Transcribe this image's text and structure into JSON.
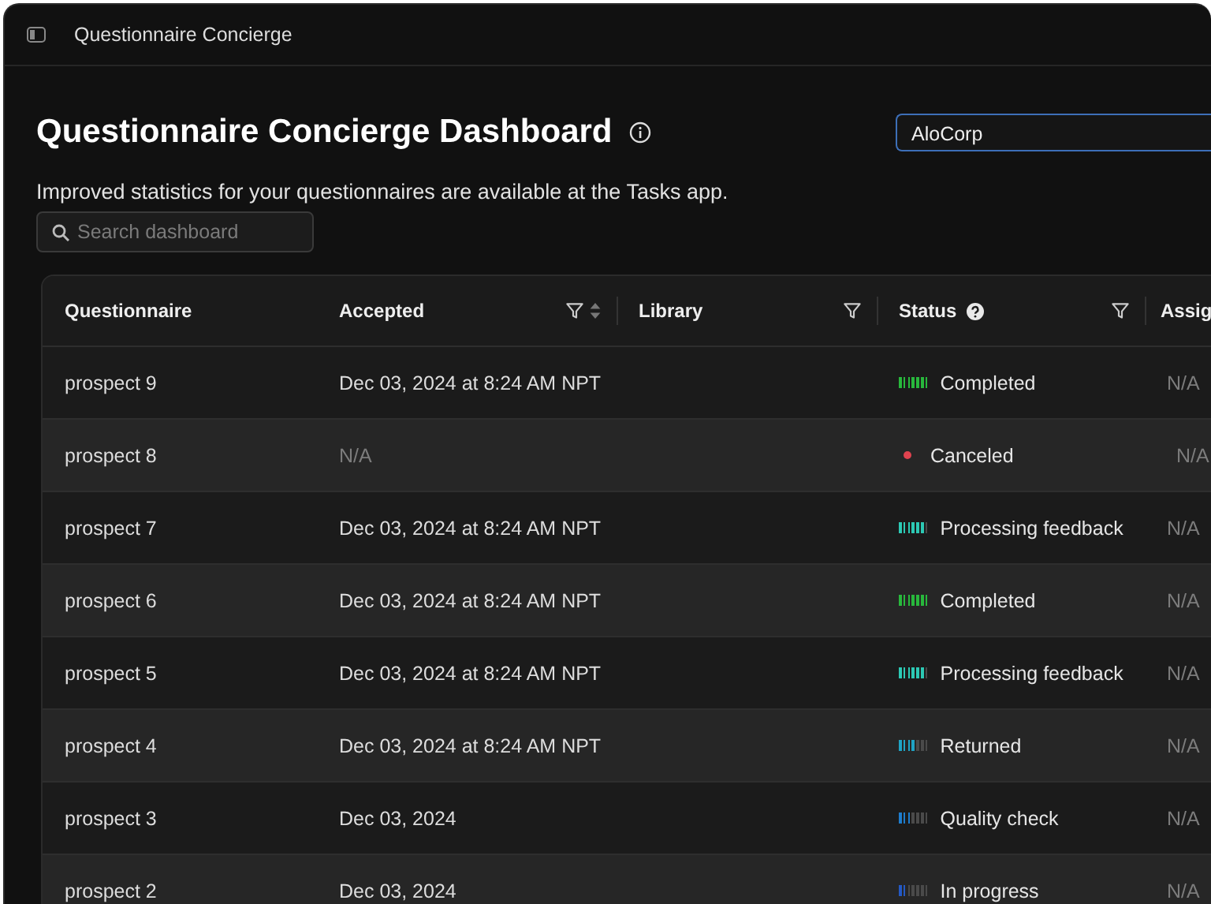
{
  "window": {
    "title": "Questionnaire Concierge"
  },
  "header": {
    "title": "Questionnaire Concierge Dashboard",
    "subtitle": "Improved statistics for your questionnaires are available at the Tasks app.",
    "organization": "AloCorp"
  },
  "search": {
    "placeholder": "Search dashboard"
  },
  "table": {
    "columns": [
      {
        "label": "Questionnaire",
        "filter": false,
        "sort": false,
        "help": false
      },
      {
        "label": "Accepted",
        "filter": true,
        "sort": true,
        "help": false
      },
      {
        "label": "Library",
        "filter": true,
        "sort": false,
        "help": false
      },
      {
        "label": "Status",
        "filter": true,
        "sort": false,
        "help": true
      },
      {
        "label": "Assig"
      }
    ],
    "rows": [
      {
        "questionnaire": "prospect 9",
        "accepted": {
          "text": "Dec 03, 2024 at 8:24 AM NPT",
          "empty": false
        },
        "status": {
          "kind": "bars",
          "level": 1,
          "color": "#28b83c",
          "label": "Completed"
        },
        "assignee": "N/A"
      },
      {
        "questionnaire": "prospect 8",
        "accepted": {
          "text": "N/A",
          "empty": true
        },
        "status": {
          "kind": "dot",
          "color": "#e0434f",
          "label": "Canceled"
        },
        "assignee": "N/A"
      },
      {
        "questionnaire": "prospect 7",
        "accepted": {
          "text": "Dec 03, 2024 at 8:24 AM NPT",
          "empty": false
        },
        "status": {
          "kind": "bars",
          "level": 0.86,
          "color": "#2cc9b4",
          "label": "Processing feedback"
        },
        "assignee": "N/A"
      },
      {
        "questionnaire": "prospect 6",
        "accepted": {
          "text": "Dec 03, 2024 at 8:24 AM NPT",
          "empty": false
        },
        "status": {
          "kind": "bars",
          "level": 1,
          "color": "#28b83c",
          "label": "Completed"
        },
        "assignee": "N/A"
      },
      {
        "questionnaire": "prospect 5",
        "accepted": {
          "text": "Dec 03, 2024 at 8:24 AM NPT",
          "empty": false
        },
        "status": {
          "kind": "bars",
          "level": 0.86,
          "color": "#2cc9b4",
          "label": "Processing feedback"
        },
        "assignee": "N/A"
      },
      {
        "questionnaire": "prospect 4",
        "accepted": {
          "text": "Dec 03, 2024 at 8:24 AM NPT",
          "empty": false
        },
        "status": {
          "kind": "bars",
          "level": 0.57,
          "color": "#1fa3c4",
          "label": "Returned"
        },
        "assignee": "N/A"
      },
      {
        "questionnaire": "prospect 3",
        "accepted": {
          "text": "Dec 03, 2024",
          "empty": false
        },
        "status": {
          "kind": "bars",
          "level": 0.43,
          "color": "#1e7ccc",
          "label": "Quality check"
        },
        "assignee": "N/A"
      },
      {
        "questionnaire": "prospect 2",
        "accepted": {
          "text": "Dec 03, 2024",
          "empty": false
        },
        "status": {
          "kind": "bars",
          "level": 0.29,
          "color": "#2459c4",
          "label": "In progress"
        },
        "assignee": "N/A"
      }
    ]
  }
}
